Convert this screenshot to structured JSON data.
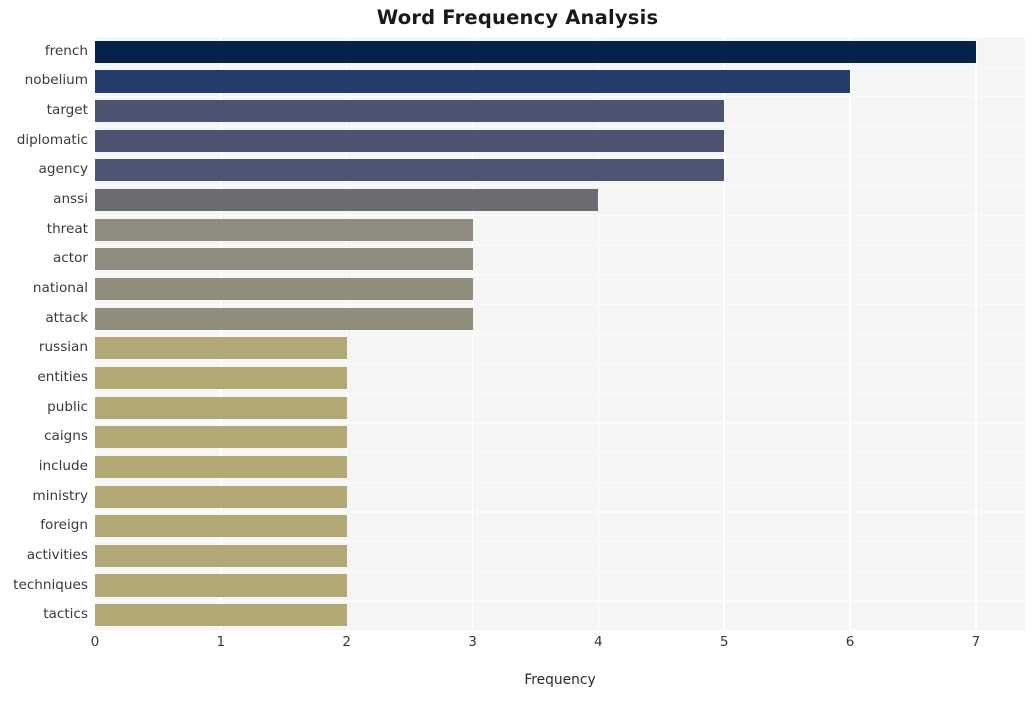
{
  "chart_data": {
    "type": "bar",
    "orientation": "horizontal",
    "title": "Word Frequency Analysis",
    "xlabel": "Frequency",
    "ylabel": "",
    "xlim": [
      0,
      7.39
    ],
    "xticks": [
      0,
      1,
      2,
      3,
      4,
      5,
      6,
      7
    ],
    "xtick_labels": [
      "0",
      "1",
      "2",
      "3",
      "4",
      "5",
      "6",
      "7"
    ],
    "grid": true,
    "grid_axis": "x",
    "legend": false,
    "categories": [
      "french",
      "nobelium",
      "target",
      "diplomatic",
      "agency",
      "anssi",
      "threat",
      "actor",
      "national",
      "attack",
      "russian",
      "entities",
      "public",
      "caigns",
      "include",
      "ministry",
      "foreign",
      "activities",
      "techniques",
      "tactics"
    ],
    "values": [
      7,
      6,
      5,
      5,
      5,
      4,
      3,
      3,
      3,
      3,
      2,
      2,
      2,
      2,
      2,
      2,
      2,
      2,
      2,
      2
    ],
    "bar_colors": [
      "#05224a",
      "#243c6c",
      "#4b5370",
      "#4c5471",
      "#4e5572",
      "#6b6d73",
      "#8f8b7e",
      "#908c7d",
      "#918d7d",
      "#918d7d",
      "#b2a873",
      "#b2a873",
      "#b2a873",
      "#b2a873",
      "#b2a873",
      "#b2a873",
      "#b2a873",
      "#b2a873",
      "#b2a873",
      "#b2a873"
    ],
    "plot_background": "#f5f5f6",
    "gridline_color": "#ffffff",
    "figure_background": "#ffffff"
  }
}
